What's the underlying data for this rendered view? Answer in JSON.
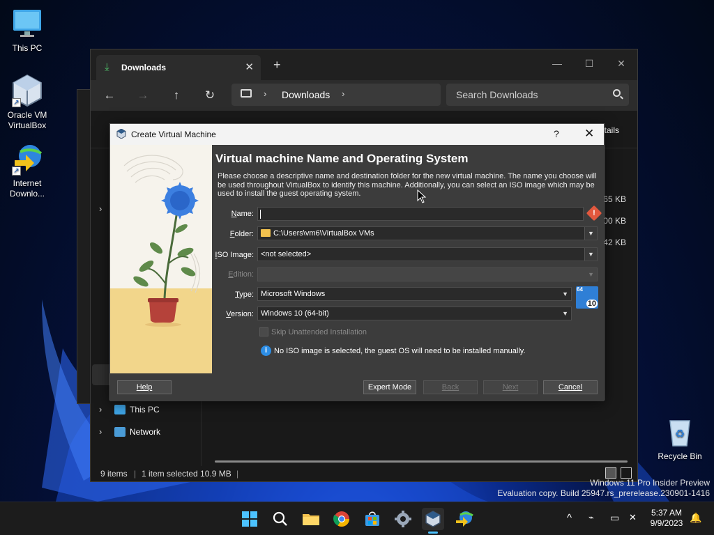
{
  "desktop": {
    "icons": [
      {
        "name": "this-pc",
        "label": "This PC"
      },
      {
        "name": "oracle-vm-virtualbox",
        "label_line1": "Oracle VM",
        "label_line2": "VirtualBox"
      },
      {
        "name": "internet-download-manager",
        "label_line1": "Internet",
        "label_line2": "Downlo..."
      },
      {
        "name": "recycle-bin",
        "label": "Recycle Bin"
      }
    ]
  },
  "explorer": {
    "tab_title": "Downloads",
    "tab_close": "✕",
    "new_tab": "+",
    "address": {
      "crumb": "Downloads",
      "sep": "›"
    },
    "search_placeholder": "Search Downloads",
    "nav_back": "←",
    "nav_forward": "→",
    "nav_up": "↑",
    "nav_refresh": "↻",
    "win_minimize": "—",
    "win_maximize": "☐",
    "win_close": "✕",
    "details_label": "tails",
    "sizes": [
      "65 KB",
      "00 KB",
      "42 KB"
    ],
    "nav_items": [
      {
        "label": "This PC"
      },
      {
        "label": "Network"
      }
    ],
    "chevron": "›",
    "status": {
      "items": "9 items",
      "selected": "1 item selected  10.9 MB"
    }
  },
  "dialog": {
    "title": "Create Virtual Machine",
    "help_q": "?",
    "close": "✕",
    "heading": "Virtual machine Name and Operating System",
    "description": "Please choose a descriptive name and destination folder for the new virtual machine. The name you choose will be used throughout VirtualBox to identify this machine. Additionally, you can select an ISO image which may be used to install the guest operating system.",
    "fields": {
      "name": {
        "label_pre": "",
        "label_u": "N",
        "label_post": "ame:",
        "value": ""
      },
      "folder": {
        "label_pre": "",
        "label_u": "F",
        "label_post": "older:",
        "value": "C:\\Users\\vm6\\VirtualBox VMs"
      },
      "iso": {
        "label_pre": "",
        "label_u": "I",
        "label_post": "SO Image:",
        "value": "<not selected>"
      },
      "edition": {
        "label_pre": "",
        "label_u": "E",
        "label_post": "dition:",
        "value": ""
      },
      "type": {
        "label_pre": "",
        "label_u": "T",
        "label_post": "ype:",
        "value": "Microsoft Windows"
      },
      "version": {
        "label_pre": "",
        "label_u": "V",
        "label_post": "ersion:",
        "value": "Windows 10 (64-bit)"
      }
    },
    "warn_glyph": "!",
    "os_badge": {
      "top": "64",
      "bottom": "10"
    },
    "skip_unattended": "Skip Unattended Installation",
    "info_glyph": "i",
    "info_text": "No ISO image is selected, the guest OS will need to be installed manually.",
    "buttons": {
      "help": "Help",
      "expert": "Expert Mode",
      "back": "Back",
      "next": "Next",
      "cancel": "Cancel"
    },
    "caret": "▼"
  },
  "watermark": {
    "line1": "Windows 11 Pro Insider Preview",
    "line2": "Evaluation copy. Build 25947.rs_prerelease.230901-1416"
  },
  "taskbar": {
    "time": "5:37 AM",
    "date": "9/9/2023",
    "tray_chevron": "^"
  },
  "colors": {
    "accent": "#4cc2ff",
    "vbox_blue": "#2f7fd6",
    "warning": "#e2583e"
  }
}
